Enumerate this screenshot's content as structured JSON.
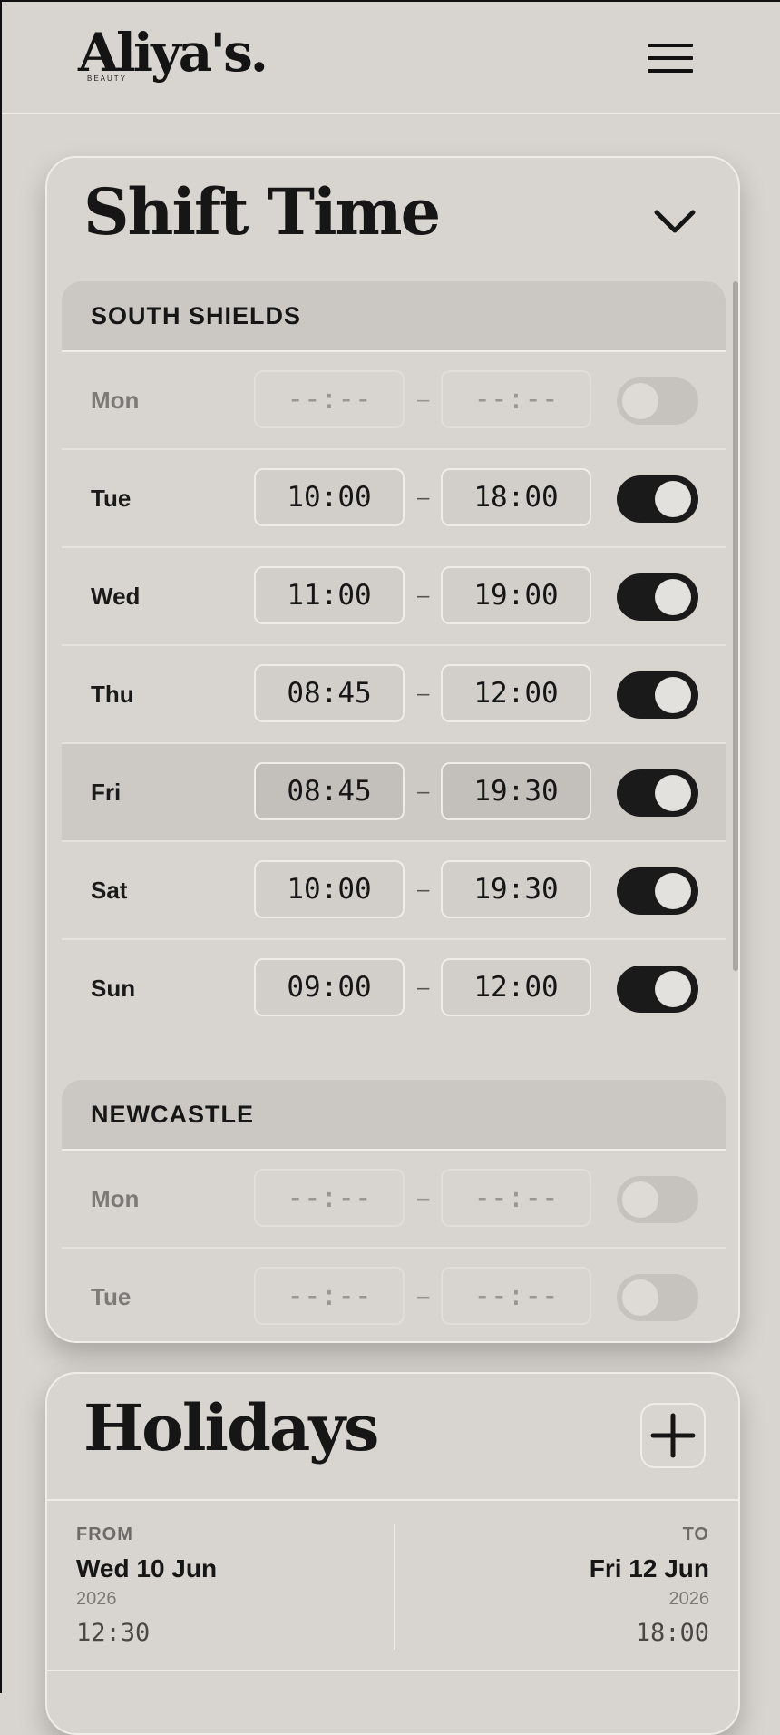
{
  "header": {
    "logo_text": "Aliya's.",
    "logo_sub": "BEAUTY",
    "menu_icon": "hamburger-menu-icon"
  },
  "shift_card": {
    "title": "Shift Time",
    "toggle_icon": "chevron-down-icon",
    "locations": [
      {
        "name": "SOUTH SHIELDS",
        "days": [
          {
            "day": "Mon",
            "start": "--:--",
            "end": "--:--",
            "enabled": false
          },
          {
            "day": "Tue",
            "start": "10:00",
            "end": "18:00",
            "enabled": true
          },
          {
            "day": "Wed",
            "start": "11:00",
            "end": "19:00",
            "enabled": true
          },
          {
            "day": "Thu",
            "start": "08:45",
            "end": "12:00",
            "enabled": true
          },
          {
            "day": "Fri",
            "start": "08:45",
            "end": "19:30",
            "enabled": true
          },
          {
            "day": "Sat",
            "start": "10:00",
            "end": "19:30",
            "enabled": true
          },
          {
            "day": "Sun",
            "start": "09:00",
            "end": "12:00",
            "enabled": true
          }
        ]
      },
      {
        "name": "NEWCASTLE",
        "days": [
          {
            "day": "Mon",
            "start": "--:--",
            "end": "--:--",
            "enabled": false
          },
          {
            "day": "Tue",
            "start": "--:--",
            "end": "--:--",
            "enabled": false
          }
        ]
      }
    ],
    "separator": "–"
  },
  "holidays_card": {
    "title": "Holidays",
    "add_icon": "plus-icon",
    "entry": {
      "from_label": "FROM",
      "from_date": "Wed 10 Jun",
      "from_year": "2026",
      "from_time": "12:30",
      "to_label": "TO",
      "to_date": "Fri 12 Jun",
      "to_year": "2026",
      "to_time": "18:00"
    }
  }
}
